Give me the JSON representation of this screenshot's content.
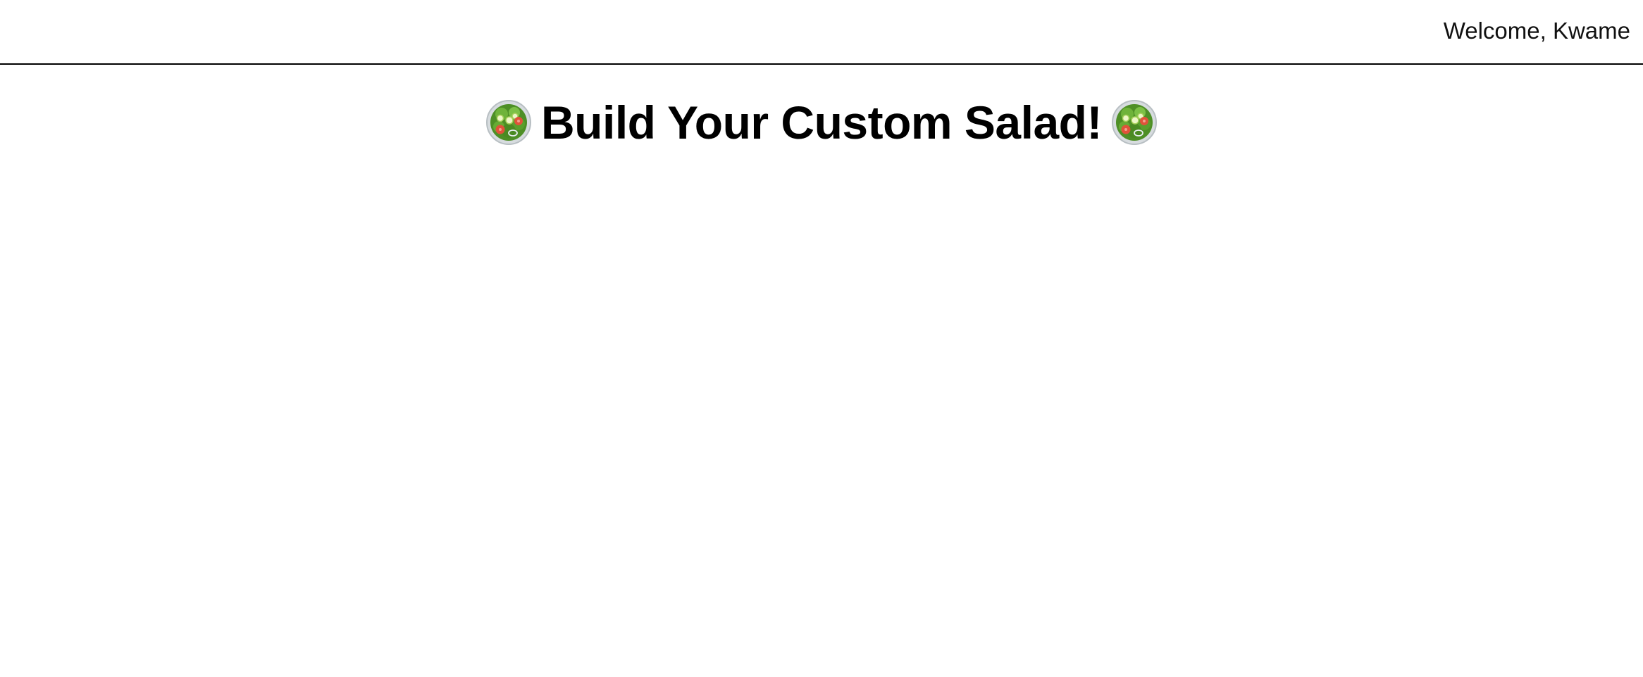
{
  "header": {
    "welcome_text": "Welcome, Kwame"
  },
  "main": {
    "title": "Build Your Custom Salad!",
    "title_icons": [
      "salad-bowl-icon",
      "salad-bowl-icon"
    ]
  },
  "colors": {
    "text": "#000000",
    "background": "#ffffff",
    "divider": "#000000",
    "lettuce": "#5aa02c",
    "tomato": "#e0533a",
    "bowl_rim": "#c9cfd2"
  }
}
